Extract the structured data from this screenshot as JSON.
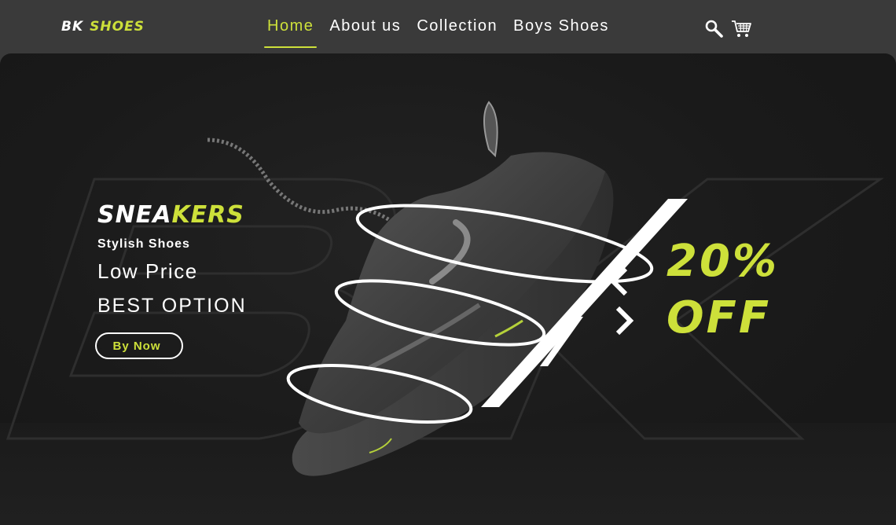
{
  "brand": {
    "part1": "BK",
    "part2": "SHOES"
  },
  "nav": {
    "items": [
      {
        "label": "Home",
        "active": true
      },
      {
        "label": "About us",
        "active": false
      },
      {
        "label": "Collection",
        "active": false
      },
      {
        "label": "Boys Shoes",
        "active": false
      }
    ]
  },
  "icons": {
    "search": "search-icon",
    "cart": "cart-icon"
  },
  "hero": {
    "title_white": "SNEA",
    "title_green": "KERS",
    "subtitle": "Stylish Shoes",
    "line1": "Low Price",
    "line2": "BEST OPTION",
    "cta_label": "By Now",
    "discount_line1": "20%",
    "discount_line2": "OFF"
  },
  "colors": {
    "accent": "#cde03a",
    "background": "#1a1a1a",
    "topbar": "#3a3a3a"
  }
}
